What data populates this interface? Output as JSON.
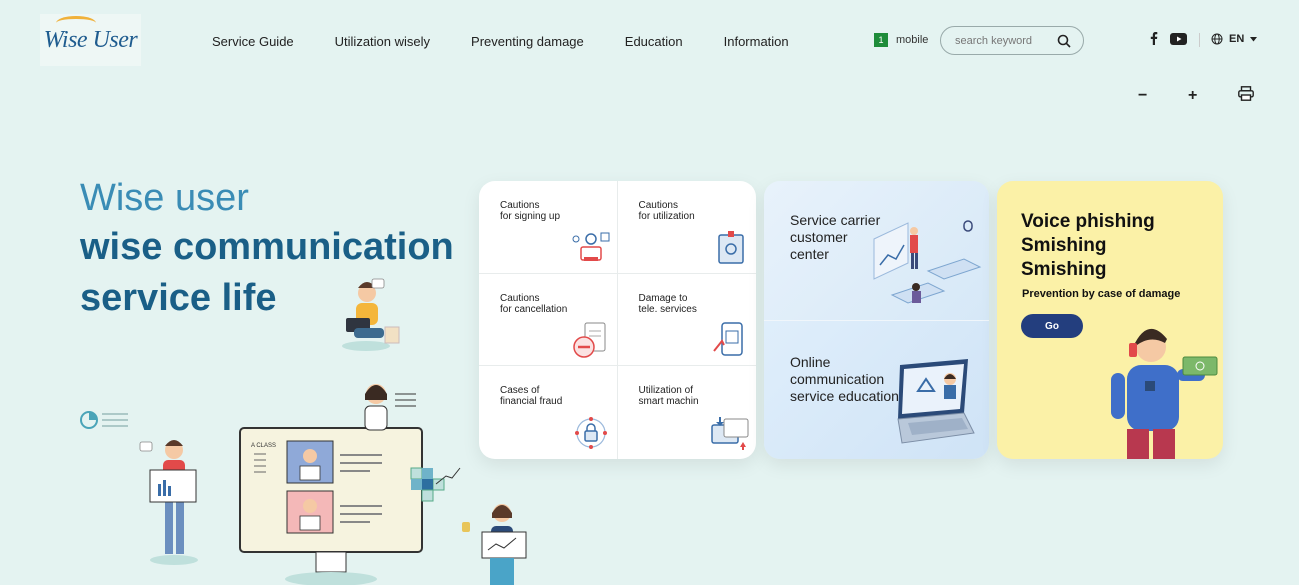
{
  "header": {
    "logo_text": "Wise User",
    "nav": [
      "Service Guide",
      "Utilization wisely",
      "Preventing damage",
      "Education",
      "Information"
    ],
    "mobile_badge": "1",
    "mobile_label": "mobile",
    "search_placeholder": "search keyword",
    "lang": "EN"
  },
  "tools": {
    "minus": "−",
    "plus": "+"
  },
  "hero": {
    "line1": "Wise user",
    "line2": "wise communication",
    "line3": "service life"
  },
  "grid": [
    {
      "l1": "Cautions",
      "l2": "for signing up"
    },
    {
      "l1": "Cautions",
      "l2": "for utilization"
    },
    {
      "l1": "Cautions",
      "l2": "for cancellation"
    },
    {
      "l1": "Damage to",
      "l2": "tele. services"
    },
    {
      "l1": "Cases of",
      "l2": "financial fraud"
    },
    {
      "l1": "Utilization of",
      "l2": "smart machin"
    }
  ],
  "blue_card": {
    "top": {
      "l1": "Service carrier",
      "l2": "customer",
      "l3": "center"
    },
    "bottom": {
      "l1": "Online",
      "l2": "communication",
      "l3": "service education"
    }
  },
  "yellow_card": {
    "l1": "Voice phishing",
    "l2": "Smishing",
    "l3": "Smishing",
    "subtitle": "Prevention by case of damage",
    "button": "Go"
  },
  "illustration": {
    "screen_label": "A CLASS"
  },
  "colors": {
    "accent": "#1a5f87",
    "go_button": "#233e7e",
    "yellow": "#fbf1a7",
    "background": "#e4f3f1"
  }
}
